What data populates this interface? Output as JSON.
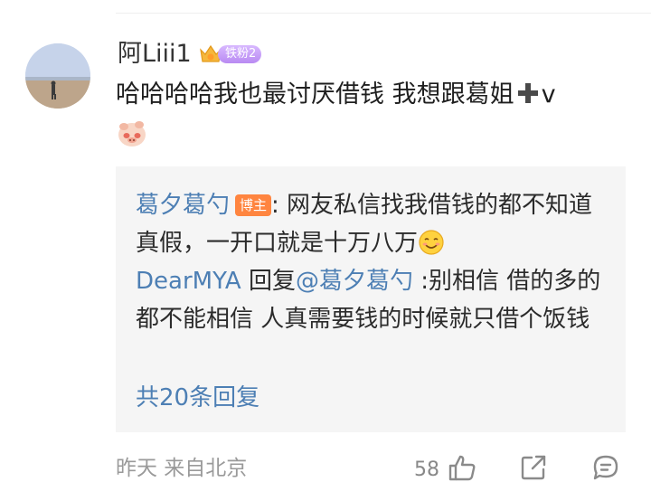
{
  "comment": {
    "username": "阿Liii1",
    "badge_text": "铁粉2",
    "text_part1": "哈哈哈哈我也最讨厌借钱 我想跟葛姐",
    "text_part2": "v"
  },
  "replies": [
    {
      "name": "葛夕葛勺",
      "tag": "博主",
      "text": ": 网友私信找我借钱的都不知道真假，一开口就是十万八万"
    },
    {
      "name": "DearMYA",
      "reply_word": " 回复",
      "mention": "@葛夕葛勺",
      "text": " :别相信 借的多的都不能相信 人真需要钱的时候就只借个饭钱"
    }
  ],
  "more_replies": "共20条回复",
  "footer": {
    "time_location": "昨天  来自北京",
    "like_count": "58"
  },
  "icons": {
    "like": "thumbs-up-icon",
    "share": "share-icon",
    "reply": "comment-icon",
    "plus": "heavy-plus-icon",
    "smile": "smiling-face-icon"
  },
  "colors": {
    "name_link": "#4d7fb4",
    "host_tag": "#ff8540",
    "reply_bg": "#f5f5f5"
  }
}
